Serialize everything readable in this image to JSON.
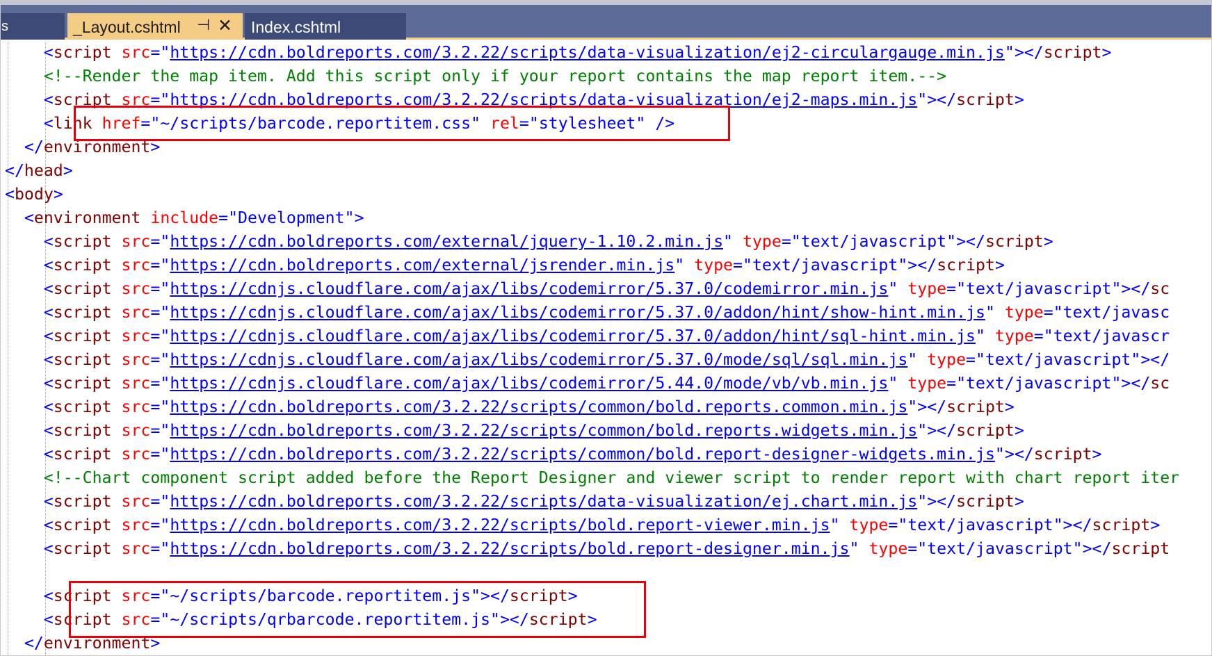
{
  "tabs": {
    "overflow_glyph": "s",
    "active": {
      "label": "_Layout.cshtml",
      "pin_icon": "pin-icon",
      "close_icon": "close-icon"
    },
    "inactive": {
      "label": "Index.cshtml"
    }
  },
  "colors": {
    "tab_bar": "#5d6b99",
    "active_tab": "#f5cc84",
    "tag": "#800000",
    "attribute": "#ff0000",
    "value": "#0000ff",
    "comment": "#008000",
    "highlight_box": "#e8000d"
  },
  "code": {
    "lines": [
      {
        "indent": 4,
        "parts": [
          {
            "k": "p",
            "s": "<"
          },
          {
            "k": "t",
            "s": "script"
          },
          {
            "k": "p",
            "s": " "
          },
          {
            "k": "a",
            "s": "src"
          },
          {
            "k": "p",
            "s": "=\""
          },
          {
            "k": "u",
            "s": "https://cdn.boldreports.com/3.2.22/scripts/data-visualization/ej2-circulargauge.min.js"
          },
          {
            "k": "p",
            "s": "\"></"
          },
          {
            "k": "t",
            "s": "script"
          },
          {
            "k": "p",
            "s": ">"
          }
        ]
      },
      {
        "indent": 4,
        "parts": [
          {
            "k": "c",
            "s": "<!--Render the map item. Add this script only if your report contains the map report item.-->"
          }
        ]
      },
      {
        "indent": 4,
        "parts": [
          {
            "k": "p",
            "s": "<"
          },
          {
            "k": "t",
            "s": "script"
          },
          {
            "k": "p",
            "s": " "
          },
          {
            "k": "a",
            "s": "src"
          },
          {
            "k": "p",
            "s": "=\""
          },
          {
            "k": "u",
            "s": "https://cdn.boldreports.com/3.2.22/scripts/data-visualization/ej2-maps.min.js"
          },
          {
            "k": "p",
            "s": "\"></"
          },
          {
            "k": "t",
            "s": "script"
          },
          {
            "k": "p",
            "s": ">"
          }
        ]
      },
      {
        "indent": 4,
        "parts": [
          {
            "k": "p",
            "s": "<"
          },
          {
            "k": "t",
            "s": "link"
          },
          {
            "k": "p",
            "s": " "
          },
          {
            "k": "a",
            "s": "href"
          },
          {
            "k": "p",
            "s": "=\""
          },
          {
            "k": "v",
            "s": "~/scripts/barcode.reportitem.css"
          },
          {
            "k": "p",
            "s": "\" "
          },
          {
            "k": "a",
            "s": "rel"
          },
          {
            "k": "p",
            "s": "=\""
          },
          {
            "k": "v",
            "s": "stylesheet"
          },
          {
            "k": "p",
            "s": "\" />"
          }
        ]
      },
      {
        "indent": 2,
        "parts": [
          {
            "k": "p",
            "s": "</"
          },
          {
            "k": "t",
            "s": "environment"
          },
          {
            "k": "p",
            "s": ">"
          }
        ]
      },
      {
        "indent": 0,
        "parts": [
          {
            "k": "p",
            "s": "</"
          },
          {
            "k": "t",
            "s": "head"
          },
          {
            "k": "p",
            "s": ">"
          }
        ]
      },
      {
        "indent": 0,
        "parts": [
          {
            "k": "p",
            "s": "<"
          },
          {
            "k": "t",
            "s": "body"
          },
          {
            "k": "p",
            "s": ">"
          }
        ]
      },
      {
        "indent": 2,
        "parts": [
          {
            "k": "p",
            "s": "<"
          },
          {
            "k": "t",
            "s": "environment"
          },
          {
            "k": "p",
            "s": " "
          },
          {
            "k": "a",
            "s": "include"
          },
          {
            "k": "p",
            "s": "=\""
          },
          {
            "k": "v",
            "s": "Development"
          },
          {
            "k": "p",
            "s": "\">"
          }
        ]
      },
      {
        "indent": 4,
        "parts": [
          {
            "k": "p",
            "s": "<"
          },
          {
            "k": "t",
            "s": "script"
          },
          {
            "k": "p",
            "s": " "
          },
          {
            "k": "a",
            "s": "src"
          },
          {
            "k": "p",
            "s": "=\""
          },
          {
            "k": "u",
            "s": "https://cdn.boldreports.com/external/jquery-1.10.2.min.js"
          },
          {
            "k": "p",
            "s": "\" "
          },
          {
            "k": "a",
            "s": "type"
          },
          {
            "k": "p",
            "s": "=\""
          },
          {
            "k": "v",
            "s": "text/javascript"
          },
          {
            "k": "p",
            "s": "\"></"
          },
          {
            "k": "t",
            "s": "script"
          },
          {
            "k": "p",
            "s": ">"
          }
        ]
      },
      {
        "indent": 4,
        "parts": [
          {
            "k": "p",
            "s": "<"
          },
          {
            "k": "t",
            "s": "script"
          },
          {
            "k": "p",
            "s": " "
          },
          {
            "k": "a",
            "s": "src"
          },
          {
            "k": "p",
            "s": "=\""
          },
          {
            "k": "u",
            "s": "https://cdn.boldreports.com/external/jsrender.min.js"
          },
          {
            "k": "p",
            "s": "\" "
          },
          {
            "k": "a",
            "s": "type"
          },
          {
            "k": "p",
            "s": "=\""
          },
          {
            "k": "v",
            "s": "text/javascript"
          },
          {
            "k": "p",
            "s": "\"></"
          },
          {
            "k": "t",
            "s": "script"
          },
          {
            "k": "p",
            "s": ">"
          }
        ]
      },
      {
        "indent": 4,
        "parts": [
          {
            "k": "p",
            "s": "<"
          },
          {
            "k": "t",
            "s": "script"
          },
          {
            "k": "p",
            "s": " "
          },
          {
            "k": "a",
            "s": "src"
          },
          {
            "k": "p",
            "s": "=\""
          },
          {
            "k": "u",
            "s": "https://cdnjs.cloudflare.com/ajax/libs/codemirror/5.37.0/codemirror.min.js"
          },
          {
            "k": "p",
            "s": "\" "
          },
          {
            "k": "a",
            "s": "type"
          },
          {
            "k": "p",
            "s": "=\""
          },
          {
            "k": "v",
            "s": "text/javascript"
          },
          {
            "k": "p",
            "s": "\"></"
          },
          {
            "k": "t",
            "s": "sc"
          }
        ]
      },
      {
        "indent": 4,
        "parts": [
          {
            "k": "p",
            "s": "<"
          },
          {
            "k": "t",
            "s": "script"
          },
          {
            "k": "p",
            "s": " "
          },
          {
            "k": "a",
            "s": "src"
          },
          {
            "k": "p",
            "s": "=\""
          },
          {
            "k": "u",
            "s": "https://cdnjs.cloudflare.com/ajax/libs/codemirror/5.37.0/addon/hint/show-hint.min.js"
          },
          {
            "k": "p",
            "s": "\" "
          },
          {
            "k": "a",
            "s": "type"
          },
          {
            "k": "p",
            "s": "=\""
          },
          {
            "k": "v",
            "s": "text/javasc"
          }
        ]
      },
      {
        "indent": 4,
        "parts": [
          {
            "k": "p",
            "s": "<"
          },
          {
            "k": "t",
            "s": "script"
          },
          {
            "k": "p",
            "s": " "
          },
          {
            "k": "a",
            "s": "src"
          },
          {
            "k": "p",
            "s": "=\""
          },
          {
            "k": "u",
            "s": "https://cdnjs.cloudflare.com/ajax/libs/codemirror/5.37.0/addon/hint/sql-hint.min.js"
          },
          {
            "k": "p",
            "s": "\" "
          },
          {
            "k": "a",
            "s": "type"
          },
          {
            "k": "p",
            "s": "=\""
          },
          {
            "k": "v",
            "s": "text/javascr"
          }
        ]
      },
      {
        "indent": 4,
        "parts": [
          {
            "k": "p",
            "s": "<"
          },
          {
            "k": "t",
            "s": "script"
          },
          {
            "k": "p",
            "s": " "
          },
          {
            "k": "a",
            "s": "src"
          },
          {
            "k": "p",
            "s": "=\""
          },
          {
            "k": "u",
            "s": "https://cdnjs.cloudflare.com/ajax/libs/codemirror/5.37.0/mode/sql/sql.min.js"
          },
          {
            "k": "p",
            "s": "\" "
          },
          {
            "k": "a",
            "s": "type"
          },
          {
            "k": "p",
            "s": "=\""
          },
          {
            "k": "v",
            "s": "text/javascript"
          },
          {
            "k": "p",
            "s": "\"></"
          }
        ]
      },
      {
        "indent": 4,
        "parts": [
          {
            "k": "p",
            "s": "<"
          },
          {
            "k": "t",
            "s": "script"
          },
          {
            "k": "p",
            "s": " "
          },
          {
            "k": "a",
            "s": "src"
          },
          {
            "k": "p",
            "s": "=\""
          },
          {
            "k": "u",
            "s": "https://cdnjs.cloudflare.com/ajax/libs/codemirror/5.44.0/mode/vb/vb.min.js"
          },
          {
            "k": "p",
            "s": "\" "
          },
          {
            "k": "a",
            "s": "type"
          },
          {
            "k": "p",
            "s": "=\""
          },
          {
            "k": "v",
            "s": "text/javascript"
          },
          {
            "k": "p",
            "s": "\"></"
          },
          {
            "k": "t",
            "s": "sc"
          }
        ]
      },
      {
        "indent": 4,
        "parts": [
          {
            "k": "p",
            "s": "<"
          },
          {
            "k": "t",
            "s": "script"
          },
          {
            "k": "p",
            "s": " "
          },
          {
            "k": "a",
            "s": "src"
          },
          {
            "k": "p",
            "s": "=\""
          },
          {
            "k": "u",
            "s": "https://cdn.boldreports.com/3.2.22/scripts/common/bold.reports.common.min.js"
          },
          {
            "k": "p",
            "s": "\"></"
          },
          {
            "k": "t",
            "s": "script"
          },
          {
            "k": "p",
            "s": ">"
          }
        ]
      },
      {
        "indent": 4,
        "parts": [
          {
            "k": "p",
            "s": "<"
          },
          {
            "k": "t",
            "s": "script"
          },
          {
            "k": "p",
            "s": " "
          },
          {
            "k": "a",
            "s": "src"
          },
          {
            "k": "p",
            "s": "=\""
          },
          {
            "k": "u",
            "s": "https://cdn.boldreports.com/3.2.22/scripts/common/bold.reports.widgets.min.js"
          },
          {
            "k": "p",
            "s": "\"></"
          },
          {
            "k": "t",
            "s": "script"
          },
          {
            "k": "p",
            "s": ">"
          }
        ]
      },
      {
        "indent": 4,
        "parts": [
          {
            "k": "p",
            "s": "<"
          },
          {
            "k": "t",
            "s": "script"
          },
          {
            "k": "p",
            "s": " "
          },
          {
            "k": "a",
            "s": "src"
          },
          {
            "k": "p",
            "s": "=\""
          },
          {
            "k": "u",
            "s": "https://cdn.boldreports.com/3.2.22/scripts/common/bold.report-designer-widgets.min.js"
          },
          {
            "k": "p",
            "s": "\"></"
          },
          {
            "k": "t",
            "s": "script"
          },
          {
            "k": "p",
            "s": ">"
          }
        ]
      },
      {
        "indent": 4,
        "parts": [
          {
            "k": "c",
            "s": "<!--Chart component script added before the Report Designer and viewer script to render report with chart report iter"
          }
        ]
      },
      {
        "indent": 4,
        "parts": [
          {
            "k": "p",
            "s": "<"
          },
          {
            "k": "t",
            "s": "script"
          },
          {
            "k": "p",
            "s": " "
          },
          {
            "k": "a",
            "s": "src"
          },
          {
            "k": "p",
            "s": "=\""
          },
          {
            "k": "u",
            "s": "https://cdn.boldreports.com/3.2.22/scripts/data-visualization/ej.chart.min.js"
          },
          {
            "k": "p",
            "s": "\"></"
          },
          {
            "k": "t",
            "s": "script"
          },
          {
            "k": "p",
            "s": ">"
          }
        ]
      },
      {
        "indent": 4,
        "parts": [
          {
            "k": "p",
            "s": "<"
          },
          {
            "k": "t",
            "s": "script"
          },
          {
            "k": "p",
            "s": " "
          },
          {
            "k": "a",
            "s": "src"
          },
          {
            "k": "p",
            "s": "=\""
          },
          {
            "k": "u",
            "s": "https://cdn.boldreports.com/3.2.22/scripts/bold.report-viewer.min.js"
          },
          {
            "k": "p",
            "s": "\" "
          },
          {
            "k": "a",
            "s": "type"
          },
          {
            "k": "p",
            "s": "=\""
          },
          {
            "k": "v",
            "s": "text/javascript"
          },
          {
            "k": "p",
            "s": "\"></"
          },
          {
            "k": "t",
            "s": "script"
          },
          {
            "k": "p",
            "s": ">"
          }
        ]
      },
      {
        "indent": 4,
        "parts": [
          {
            "k": "p",
            "s": "<"
          },
          {
            "k": "t",
            "s": "script"
          },
          {
            "k": "p",
            "s": " "
          },
          {
            "k": "a",
            "s": "src"
          },
          {
            "k": "p",
            "s": "=\""
          },
          {
            "k": "u",
            "s": "https://cdn.boldreports.com/3.2.22/scripts/bold.report-designer.min.js"
          },
          {
            "k": "p",
            "s": "\" "
          },
          {
            "k": "a",
            "s": "type"
          },
          {
            "k": "p",
            "s": "=\""
          },
          {
            "k": "v",
            "s": "text/javascript"
          },
          {
            "k": "p",
            "s": "\"></"
          },
          {
            "k": "t",
            "s": "script"
          }
        ]
      },
      {
        "indent": 4,
        "parts": []
      },
      {
        "indent": 4,
        "parts": [
          {
            "k": "p",
            "s": "<"
          },
          {
            "k": "t",
            "s": "script"
          },
          {
            "k": "p",
            "s": " "
          },
          {
            "k": "a",
            "s": "src"
          },
          {
            "k": "p",
            "s": "=\""
          },
          {
            "k": "v",
            "s": "~/scripts/barcode.reportitem.js"
          },
          {
            "k": "p",
            "s": "\"></"
          },
          {
            "k": "t",
            "s": "script"
          },
          {
            "k": "p",
            "s": ">"
          }
        ]
      },
      {
        "indent": 4,
        "parts": [
          {
            "k": "p",
            "s": "<"
          },
          {
            "k": "t",
            "s": "script"
          },
          {
            "k": "p",
            "s": " "
          },
          {
            "k": "a",
            "s": "src"
          },
          {
            "k": "p",
            "s": "=\""
          },
          {
            "k": "v",
            "s": "~/scripts/qrbarcode.reportitem.js"
          },
          {
            "k": "p",
            "s": "\"></"
          },
          {
            "k": "t",
            "s": "script"
          },
          {
            "k": "p",
            "s": ">"
          }
        ]
      },
      {
        "indent": 2,
        "parts": [
          {
            "k": "p",
            "s": "</"
          },
          {
            "k": "t",
            "s": "environment"
          },
          {
            "k": "p",
            "s": ">"
          }
        ]
      }
    ]
  }
}
